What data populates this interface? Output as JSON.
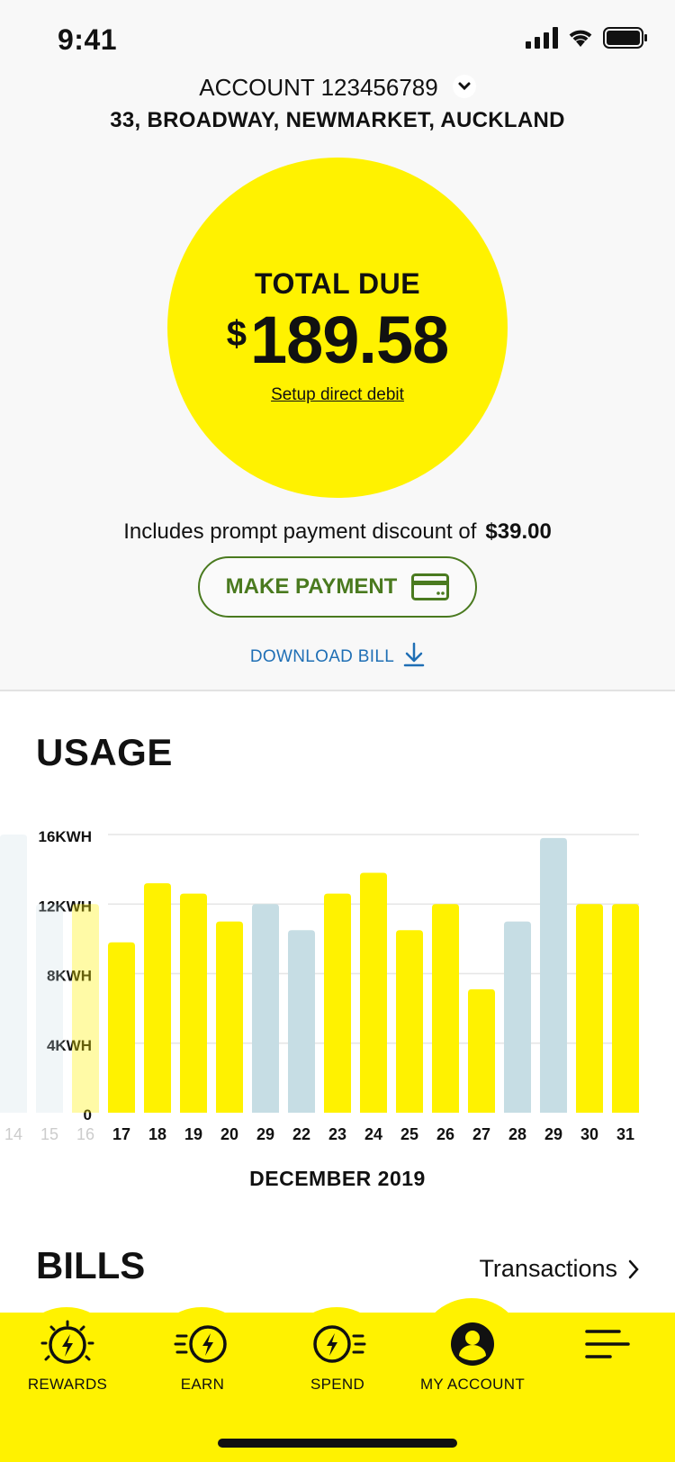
{
  "status_bar": {
    "time": "9:41"
  },
  "account": {
    "label": "ACCOUNT 123456789",
    "address": "33, BROADWAY, NEWMARKET, AUCKLAND"
  },
  "balance": {
    "label": "TOTAL DUE",
    "currency": "$",
    "amount": "189.58",
    "setup_link": "Setup direct debit",
    "discount_text": "Includes prompt payment discount of",
    "discount_amount": "$39.00",
    "pay_button": "MAKE PAYMENT",
    "download_link": "DOWNLOAD BILL"
  },
  "usage": {
    "title": "USAGE",
    "month": "DECEMBER 2019"
  },
  "bills": {
    "title": "BILLS",
    "transactions_link": "Transactions"
  },
  "nav": {
    "items": [
      {
        "label": "REWARDS",
        "icon": "rewards-icon"
      },
      {
        "label": "EARN",
        "icon": "earn-icon"
      },
      {
        "label": "SPEND",
        "icon": "spend-icon"
      },
      {
        "label": "MY ACCOUNT",
        "icon": "account-icon"
      },
      {
        "label": "",
        "icon": "menu-icon"
      }
    ]
  },
  "colors": {
    "accent": "#fff200",
    "bar_alt": "#c6dde4",
    "pay_green": "#4a7a1f",
    "link_blue": "#1f6fb5"
  },
  "chart_data": {
    "type": "bar",
    "categories": [
      "14",
      "15",
      "16",
      "17",
      "18",
      "19",
      "20",
      "29",
      "22",
      "23",
      "24",
      "25",
      "26",
      "27",
      "28",
      "29",
      "30",
      "31"
    ],
    "values": [
      16,
      12,
      12,
      9.8,
      13.2,
      12.6,
      11,
      12,
      10.5,
      12.6,
      13.8,
      10.5,
      12,
      7.1,
      11,
      15.8,
      12,
      12
    ],
    "faded": [
      true,
      true,
      true,
      false,
      false,
      false,
      false,
      false,
      false,
      false,
      false,
      false,
      false,
      false,
      false,
      false,
      false,
      false
    ],
    "highlight_alt": [
      false,
      false,
      false,
      false,
      false,
      false,
      false,
      true,
      true,
      false,
      false,
      false,
      false,
      false,
      true,
      true,
      false,
      false
    ],
    "y_ticks": [
      "0",
      "4KWH",
      "8KWH",
      "12KWH",
      "16KWH"
    ],
    "ylim": [
      0,
      16
    ],
    "grid": true,
    "xlabel": "DECEMBER 2019"
  }
}
